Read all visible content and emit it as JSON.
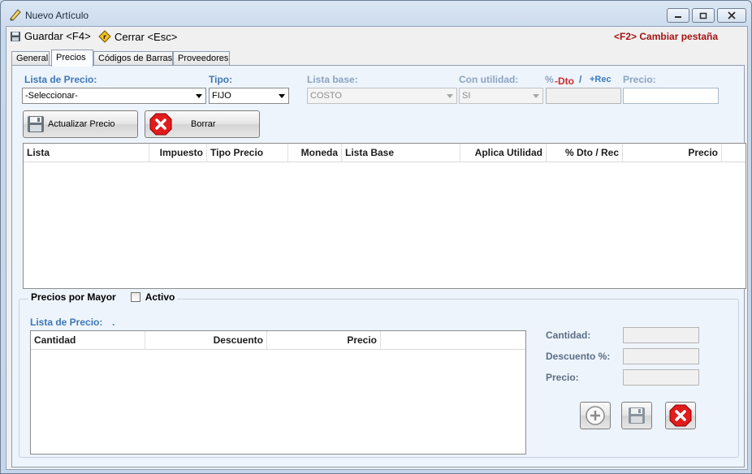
{
  "window": {
    "title": "Nuevo Artículo"
  },
  "toolbar": {
    "save_label": "Guardar <F4>",
    "close_label": "Cerrar <Esc>",
    "switch_tab_hint": "<F2> Cambiar pestaña"
  },
  "tabs": [
    {
      "label": "General",
      "active": false
    },
    {
      "label": "Precios",
      "active": true
    },
    {
      "label": "Códigos de Barras",
      "active": false
    },
    {
      "label": "Proveedores",
      "active": false
    }
  ],
  "price_form": {
    "lista_label": "Lista de Precio:",
    "lista_value": "-Seleccionar-",
    "tipo_label": "Tipo:",
    "tipo_value": "FIJO",
    "lista_base_label": "Lista base:",
    "lista_base_value": "COSTO",
    "utilidad_label": "Con utilidad:",
    "utilidad_value": "SI",
    "pct_label": "%",
    "dto_label": "-Dto",
    "slash_label": "/",
    "rec_label": "+Rec",
    "precio_label": "Precio:",
    "pct_value": "",
    "precio_value": ""
  },
  "buttons": {
    "update_price": "Actualizar Precio",
    "delete": "Borrar"
  },
  "price_grid": {
    "columns": [
      "Lista",
      "Impuesto",
      "Tipo Precio",
      "Moneda",
      "Lista Base",
      "Aplica Utilidad",
      "% Dto / Rec",
      "Precio"
    ],
    "rows": []
  },
  "wholesale": {
    "group_title": "Precios por Mayor",
    "active_label": "Activo",
    "active_checked": false,
    "lista_label": "Lista de Precio:",
    "lista_value": ".",
    "columns": [
      "Cantidad",
      "Descuento",
      "Precio"
    ],
    "rows": [],
    "cantidad_label": "Cantidad:",
    "descuento_label": "Descuento %:",
    "precio_label": "Precio:",
    "cantidad_value": "",
    "descuento_value": "",
    "precio_value": ""
  },
  "colors": {
    "label_blue": "#3c78b8",
    "hint_red": "#a31414",
    "tab_bg": "#eef4fb"
  }
}
